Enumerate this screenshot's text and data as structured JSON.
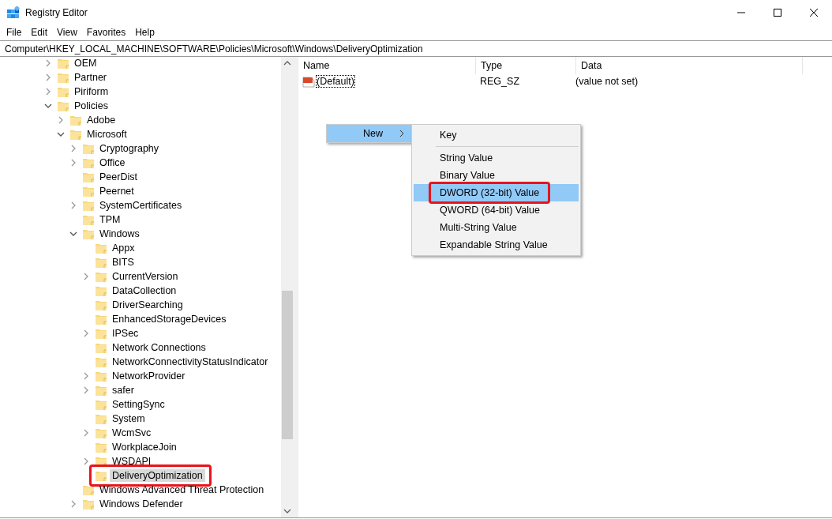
{
  "window": {
    "title": "Registry Editor"
  },
  "menu_bar": [
    "File",
    "Edit",
    "View",
    "Favorites",
    "Help"
  ],
  "address_bar": {
    "value": "Computer\\HKEY_LOCAL_MACHINE\\SOFTWARE\\Policies\\Microsoft\\Windows\\DeliveryOptimization"
  },
  "tree": [
    {
      "label": "OEM",
      "kind": "branch",
      "expanded": false,
      "selected": false,
      "annotated": false
    },
    {
      "label": "Partner",
      "kind": "branch",
      "expanded": false,
      "selected": false,
      "annotated": false
    },
    {
      "label": "Piriform",
      "kind": "branch",
      "expanded": false,
      "selected": false,
      "annotated": false
    },
    {
      "label": "Policies",
      "kind": "branch",
      "expanded": true,
      "selected": false,
      "annotated": false,
      "children": [
        {
          "label": "Adobe",
          "kind": "branch",
          "expanded": false,
          "selected": false,
          "annotated": false
        },
        {
          "label": "Microsoft",
          "kind": "branch",
          "expanded": true,
          "selected": false,
          "annotated": false,
          "children": [
            {
              "label": "Cryptography",
              "kind": "branch",
              "expanded": false,
              "selected": false,
              "annotated": false
            },
            {
              "label": "Office",
              "kind": "branch",
              "expanded": false,
              "selected": false,
              "annotated": false
            },
            {
              "label": "PeerDist",
              "kind": "leaf",
              "selected": false,
              "annotated": false
            },
            {
              "label": "Peernet",
              "kind": "leaf",
              "selected": false,
              "annotated": false
            },
            {
              "label": "SystemCertificates",
              "kind": "branch",
              "expanded": false,
              "selected": false,
              "annotated": false
            },
            {
              "label": "TPM",
              "kind": "leaf",
              "selected": false,
              "annotated": false
            },
            {
              "label": "Windows",
              "kind": "branch",
              "expanded": true,
              "selected": false,
              "annotated": false,
              "children": [
                {
                  "label": "Appx",
                  "kind": "leaf",
                  "selected": false,
                  "annotated": false
                },
                {
                  "label": "BITS",
                  "kind": "leaf",
                  "selected": false,
                  "annotated": false
                },
                {
                  "label": "CurrentVersion",
                  "kind": "branch",
                  "expanded": false,
                  "selected": false,
                  "annotated": false
                },
                {
                  "label": "DataCollection",
                  "kind": "leaf",
                  "selected": false,
                  "annotated": false
                },
                {
                  "label": "DriverSearching",
                  "kind": "leaf",
                  "selected": false,
                  "annotated": false
                },
                {
                  "label": "EnhancedStorageDevices",
                  "kind": "leaf",
                  "selected": false,
                  "annotated": false
                },
                {
                  "label": "IPSec",
                  "kind": "branch",
                  "expanded": false,
                  "selected": false,
                  "annotated": false
                },
                {
                  "label": "Network Connections",
                  "kind": "leaf",
                  "selected": false,
                  "annotated": false
                },
                {
                  "label": "NetworkConnectivityStatusIndicator",
                  "kind": "leaf",
                  "selected": false,
                  "annotated": false
                },
                {
                  "label": "NetworkProvider",
                  "kind": "branch",
                  "expanded": false,
                  "selected": false,
                  "annotated": false
                },
                {
                  "label": "safer",
                  "kind": "branch",
                  "expanded": false,
                  "selected": false,
                  "annotated": false
                },
                {
                  "label": "SettingSync",
                  "kind": "leaf",
                  "selected": false,
                  "annotated": false
                },
                {
                  "label": "System",
                  "kind": "leaf",
                  "selected": false,
                  "annotated": false
                },
                {
                  "label": "WcmSvc",
                  "kind": "branch",
                  "expanded": false,
                  "selected": false,
                  "annotated": false
                },
                {
                  "label": "WorkplaceJoin",
                  "kind": "leaf",
                  "selected": false,
                  "annotated": false
                },
                {
                  "label": "WSDAPI",
                  "kind": "branch",
                  "expanded": false,
                  "selected": false,
                  "annotated": false
                },
                {
                  "label": "DeliveryOptimization",
                  "kind": "leaf",
                  "selected": true,
                  "annotated": true
                }
              ]
            },
            {
              "label": "Windows Advanced Threat Protection",
              "kind": "leaf",
              "selected": false,
              "annotated": false
            },
            {
              "label": "Windows Defender",
              "kind": "branch",
              "expanded": false,
              "selected": false,
              "annotated": false
            }
          ]
        }
      ]
    }
  ],
  "table": {
    "columns": [
      "Name",
      "Type",
      "Data"
    ],
    "rows": [
      {
        "name": "(Default)",
        "type": "REG_SZ",
        "data": "(value not set)",
        "focused": true
      }
    ]
  },
  "context_menu": {
    "items": [
      {
        "label": "New",
        "selected": true
      }
    ]
  },
  "submenu": {
    "items": [
      {
        "kind": "item",
        "label": "Key",
        "selected": false,
        "annotated": false
      },
      {
        "kind": "separator"
      },
      {
        "kind": "item",
        "label": "String Value",
        "selected": false,
        "annotated": false
      },
      {
        "kind": "item",
        "label": "Binary Value",
        "selected": false,
        "annotated": false
      },
      {
        "kind": "item",
        "label": "DWORD (32-bit) Value",
        "selected": true,
        "annotated": true
      },
      {
        "kind": "item",
        "label": "QWORD (64-bit) Value",
        "selected": false,
        "annotated": false
      },
      {
        "kind": "item",
        "label": "Multi-String Value",
        "selected": false,
        "annotated": false
      },
      {
        "kind": "item",
        "label": "Expandable String Value",
        "selected": false,
        "annotated": false
      }
    ]
  }
}
